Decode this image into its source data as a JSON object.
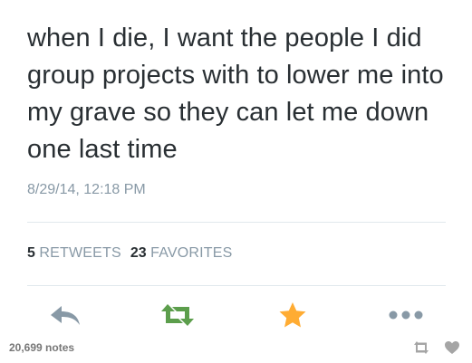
{
  "tweet": {
    "text": "when I die, I want the people I did group projects with to lower me into my grave so they can let me down one last time",
    "timestamp": "8/29/14, 12:18 PM"
  },
  "stats": {
    "retweets_count": "5",
    "retweets_label": "RETWEETS",
    "favorites_count": "23",
    "favorites_label": "FAVORITES"
  },
  "actions": {
    "reply_icon": "reply-arrow-icon",
    "retweet_icon": "retweet-icon",
    "favorite_icon": "star-icon",
    "more_icon": "ellipsis-icon"
  },
  "footer": {
    "notes": "20,699 notes",
    "reblog_icon": "reblog-icon",
    "like_icon": "heart-icon"
  },
  "colors": {
    "reply": "#8899a6",
    "retweet": "#5c9e4c",
    "favorite": "#ffac33",
    "more": "#8899a6",
    "footer_icons": "#a5a5a5"
  }
}
